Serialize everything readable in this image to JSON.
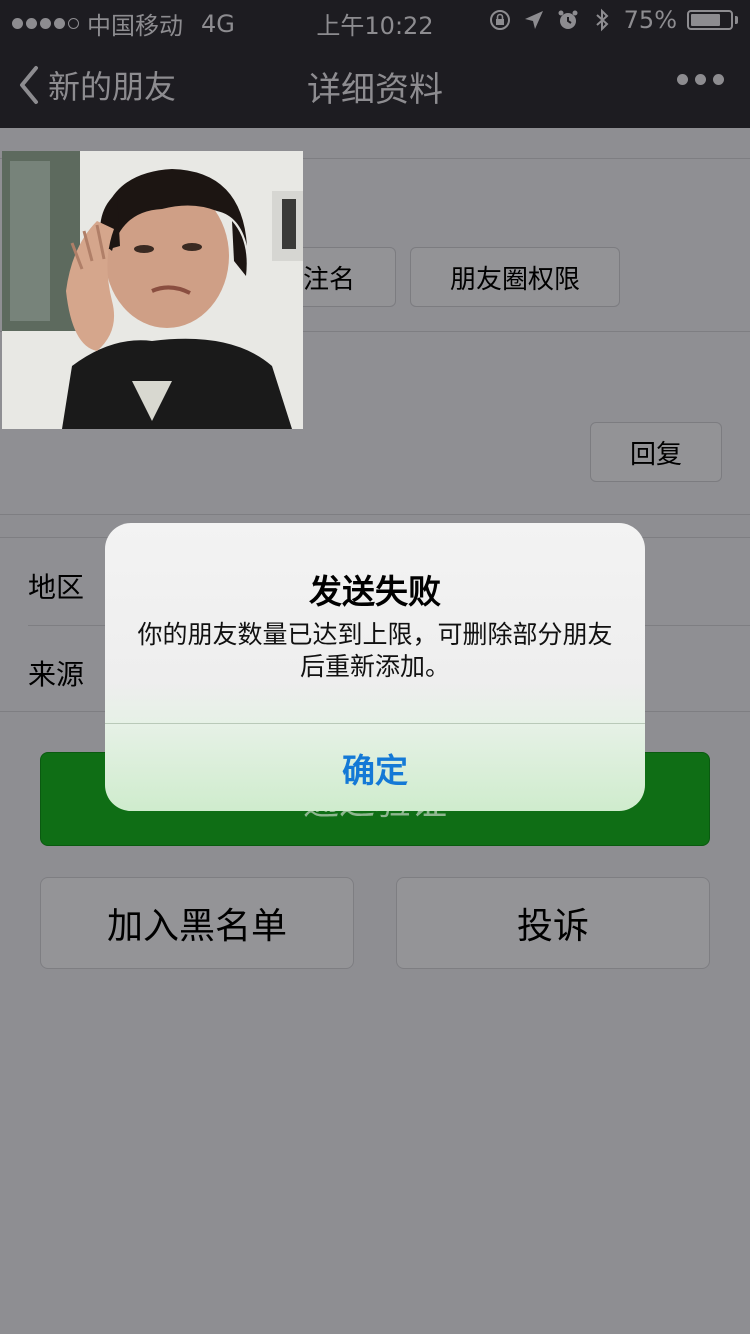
{
  "status_bar": {
    "carrier": "中国移动",
    "network": "4G",
    "time": "上午10:22",
    "battery": "75%",
    "battery_level": 0.75
  },
  "nav": {
    "back_label": "新的朋友",
    "title": "详细资料"
  },
  "profile": {
    "remark_button": "注名",
    "moments_button": "朋友圈权限",
    "reply_button": "回复"
  },
  "info": {
    "region_label": "地区",
    "source_label": "来源"
  },
  "actions": {
    "verify_label": "通过验证",
    "blacklist_label": "加入黑名单",
    "report_label": "投诉"
  },
  "alert": {
    "title": "发送失败",
    "message": "你的朋友数量已达到上限，可删除部分朋友后重新添加。",
    "ok_label": "确定"
  },
  "colors": {
    "nav_bg": "#1d1c21",
    "verify_green": "#0f6e15",
    "alert_button_blue": "#1479d6"
  }
}
